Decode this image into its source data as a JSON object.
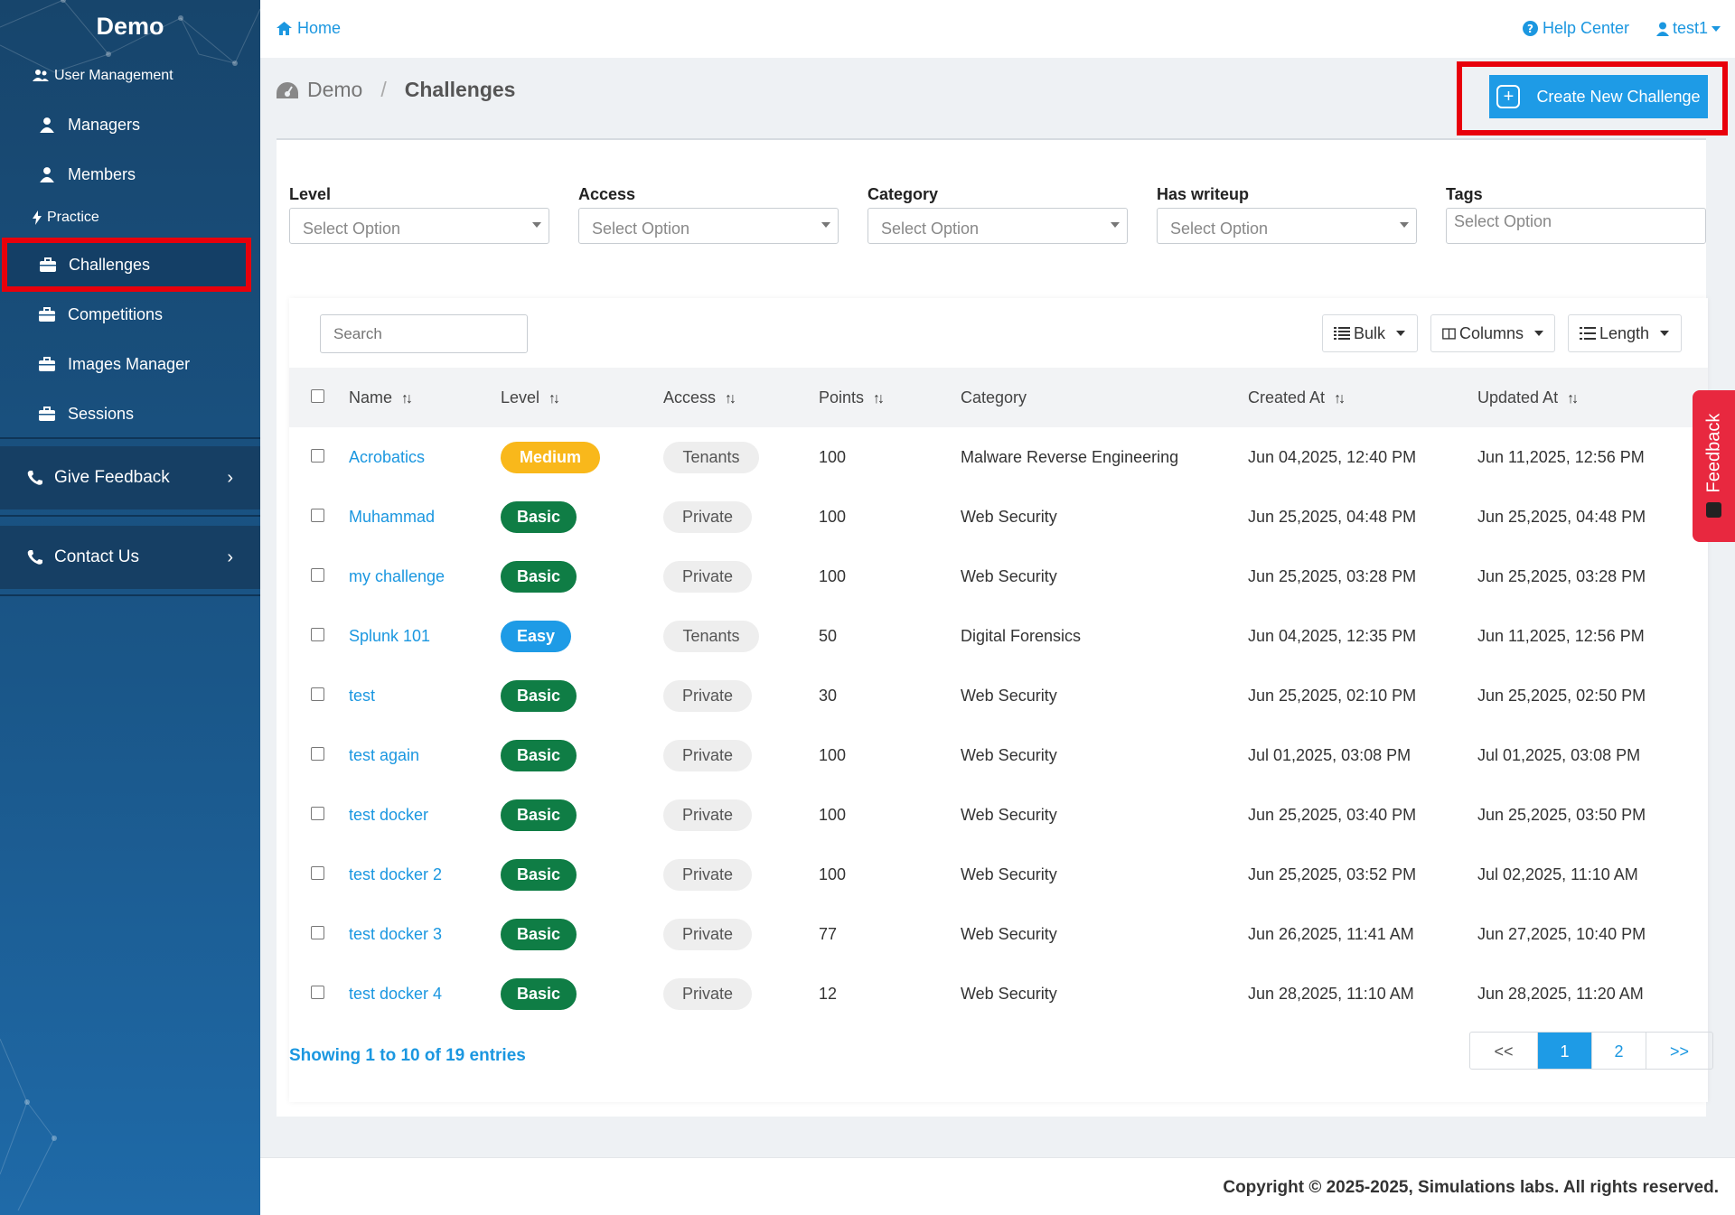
{
  "sidebar": {
    "title": "Demo",
    "section_user": "User Management",
    "section_practice": "Practice",
    "items": [
      {
        "label": "Managers"
      },
      {
        "label": "Members"
      },
      {
        "label": "Challenges"
      },
      {
        "label": "Competitions"
      },
      {
        "label": "Images Manager"
      },
      {
        "label": "Sessions"
      }
    ],
    "give_feedback": "Give Feedback",
    "contact_us": "Contact Us"
  },
  "header": {
    "home": "Home",
    "help": "Help Center",
    "user": "test1"
  },
  "breadcrumb": {
    "root": "Demo",
    "current": "Challenges"
  },
  "create_button": "Create New Challenge",
  "filters": [
    {
      "label": "Level",
      "placeholder": "Select Option"
    },
    {
      "label": "Access",
      "placeholder": "Select Option"
    },
    {
      "label": "Category",
      "placeholder": "Select Option"
    },
    {
      "label": "Has writeup",
      "placeholder": "Select Option"
    },
    {
      "label": "Tags",
      "placeholder": "Select Option"
    }
  ],
  "toolbar": {
    "search_placeholder": "Search",
    "bulk": "Bulk",
    "columns": "Columns",
    "length": "Length"
  },
  "table": {
    "headers": {
      "name": "Name",
      "level": "Level",
      "access": "Access",
      "points": "Points",
      "category": "Category",
      "created": "Created At",
      "updated": "Updated At"
    },
    "rows": [
      {
        "name": "Acrobatics",
        "level": "Medium",
        "access": "Tenants",
        "points": "100",
        "category": "Malware Reverse Engineering",
        "created": "Jun 04,2025, 12:40 PM",
        "updated": "Jun 11,2025, 12:56 PM"
      },
      {
        "name": "Muhammad",
        "level": "Basic",
        "access": "Private",
        "points": "100",
        "category": "Web Security",
        "created": "Jun 25,2025, 04:48 PM",
        "updated": "Jun 25,2025, 04:48 PM"
      },
      {
        "name": "my challenge",
        "level": "Basic",
        "access": "Private",
        "points": "100",
        "category": "Web Security",
        "created": "Jun 25,2025, 03:28 PM",
        "updated": "Jun 25,2025, 03:28 PM"
      },
      {
        "name": "Splunk 101",
        "level": "Easy",
        "access": "Tenants",
        "points": "50",
        "category": "Digital Forensics",
        "created": "Jun 04,2025, 12:35 PM",
        "updated": "Jun 11,2025, 12:56 PM"
      },
      {
        "name": "test",
        "level": "Basic",
        "access": "Private",
        "points": "30",
        "category": "Web Security",
        "created": "Jun 25,2025, 02:10 PM",
        "updated": "Jun 25,2025, 02:50 PM"
      },
      {
        "name": "test again",
        "level": "Basic",
        "access": "Private",
        "points": "100",
        "category": "Web Security",
        "created": "Jul 01,2025, 03:08 PM",
        "updated": "Jul 01,2025, 03:08 PM"
      },
      {
        "name": "test docker",
        "level": "Basic",
        "access": "Private",
        "points": "100",
        "category": "Web Security",
        "created": "Jun 25,2025, 03:40 PM",
        "updated": "Jun 25,2025, 03:50 PM"
      },
      {
        "name": "test docker 2",
        "level": "Basic",
        "access": "Private",
        "points": "100",
        "category": "Web Security",
        "created": "Jun 25,2025, 03:52 PM",
        "updated": "Jul 02,2025, 11:10 AM"
      },
      {
        "name": "test docker 3",
        "level": "Basic",
        "access": "Private",
        "points": "77",
        "category": "Web Security",
        "created": "Jun 26,2025, 11:41 AM",
        "updated": "Jun 27,2025, 10:40 PM"
      },
      {
        "name": "test docker 4",
        "level": "Basic",
        "access": "Private",
        "points": "12",
        "category": "Web Security",
        "created": "Jun 28,2025, 11:10 AM",
        "updated": "Jun 28,2025, 11:20 AM"
      }
    ]
  },
  "showing": "Showing 1 to 10 of 19 entries",
  "pager": {
    "first": "<<",
    "p1": "1",
    "p2": "2",
    "last": ">>"
  },
  "feedback_tab": "Feedback",
  "footer": "Copyright © 2025-2025, Simulations labs. All rights reserved.",
  "colors": {
    "accent": "#1e9be6",
    "highlight": "#e8000b",
    "basic": "#0f7d45",
    "medium": "#f9b81b",
    "easy": "#1e9be6"
  }
}
